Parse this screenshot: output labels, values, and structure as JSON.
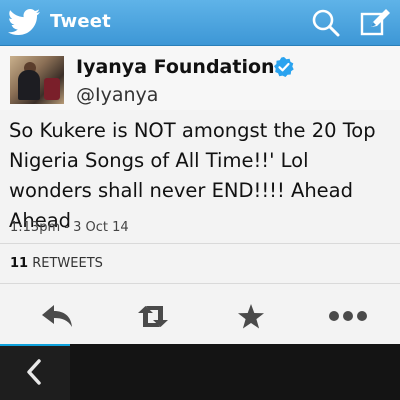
{
  "header": {
    "title": "Tweet",
    "icons": [
      "twitter-bird-icon",
      "search-icon",
      "compose-icon"
    ],
    "color": "#3d97d6"
  },
  "tweet": {
    "author_name": "Iyanya Foundation",
    "author_handle": "@Iyanya",
    "verified": true,
    "text": "So Kukere is NOT amongst the 20 Top Nigeria Songs of All Time!!' Lol wonders shall never END!!!! Ahead Ahead",
    "timestamp": "1:13pm - 3 Oct 14",
    "retweet_count": "11",
    "retweet_label": "RETWEETS"
  },
  "actions": [
    "reply-icon",
    "retweet-icon",
    "favorite-icon",
    "more-icon"
  ],
  "bottom_bar": {
    "icons": [
      "back-icon"
    ],
    "accent": "#0fa2dc"
  }
}
